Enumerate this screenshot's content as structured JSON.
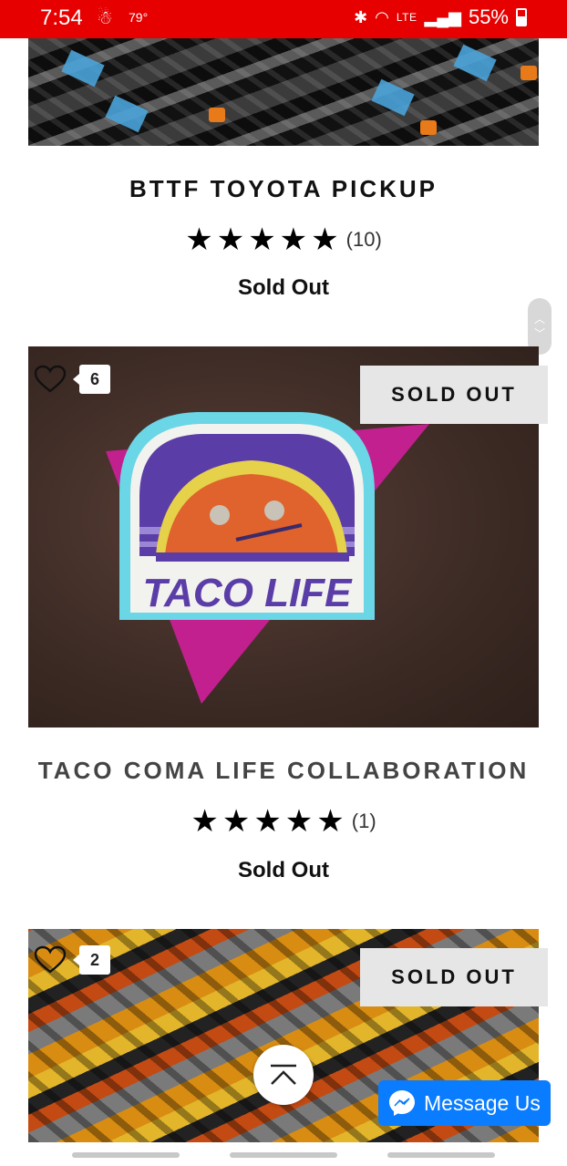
{
  "status_bar": {
    "time": "7:54",
    "temperature": "79°",
    "network": "LTE",
    "battery": "55%",
    "colors": {
      "background": "#e60000"
    }
  },
  "products": [
    {
      "title": "BTTF TOYOTA PICKUP",
      "stars": 5,
      "review_count": "(10)",
      "status": "Sold Out"
    },
    {
      "title": "TACO COMA LIFE COLLABORATION",
      "stars": 5,
      "review_count": "(1)",
      "status": "Sold Out",
      "image_text": "TACO LIFE",
      "badge": "SOLD OUT",
      "wishlist_count": "6"
    },
    {
      "badge": "SOLD OUT",
      "wishlist_count": "2"
    }
  ],
  "icons": {
    "wishlist": "heart-icon",
    "rating": "star-icon",
    "scroll_top": "chevron-up-icon",
    "messenger": "messenger-icon"
  },
  "message_button": {
    "label": "Message Us",
    "color": "#0a7cff"
  }
}
